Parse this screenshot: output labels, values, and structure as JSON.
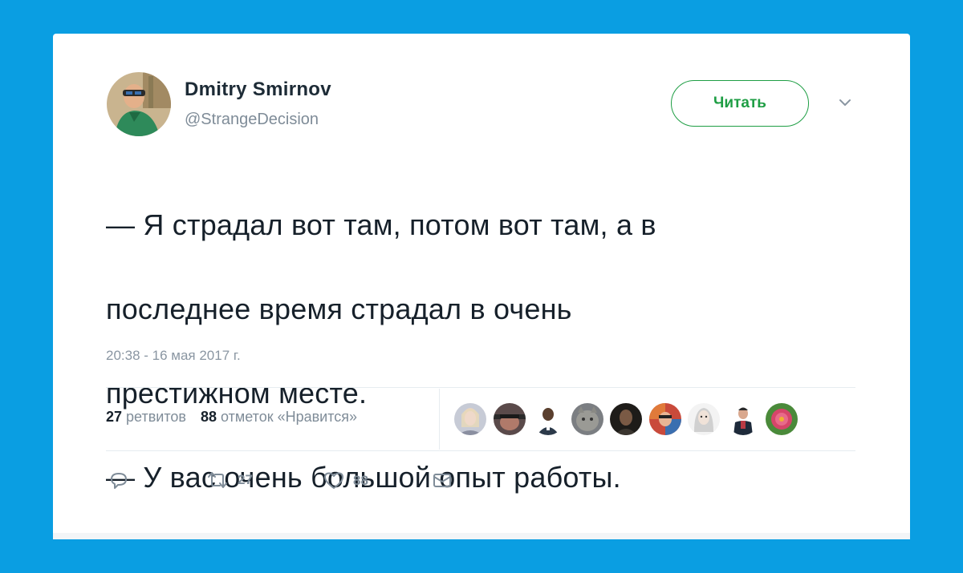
{
  "tweet": {
    "author_name": "Dmitry Smirnov",
    "author_handle": "@StrangeDecision",
    "follow_label": "Читать",
    "text_lines": [
      "— Я страдал вот там, потом вот там, а в",
      "последнее время страдал в очень",
      "престижном месте.",
      "— У вас очень большой опыт работы."
    ],
    "timestamp": "20:38 - 16 мая 2017 г."
  },
  "stats": {
    "retweets_count": "27",
    "retweets_label": "ретвитов",
    "likes_count": "88",
    "likes_label": "отметок «Нравится»"
  },
  "likers": [
    {
      "icon": "liker-avatar-1",
      "color": "#b8bcc7"
    },
    {
      "icon": "liker-avatar-2",
      "color": "#5a4a4a"
    },
    {
      "icon": "liker-avatar-3",
      "color": "#3a4550"
    },
    {
      "icon": "liker-avatar-4",
      "color": "#7b7e82"
    },
    {
      "icon": "liker-avatar-5",
      "color": "#2c2a26"
    },
    {
      "icon": "liker-avatar-6",
      "color": "#c94a3b"
    },
    {
      "icon": "liker-avatar-7",
      "color": "#d8d8d8"
    },
    {
      "icon": "liker-avatar-8",
      "color": "#b93a44"
    },
    {
      "icon": "liker-avatar-9",
      "color": "#d6456a"
    }
  ],
  "actions": {
    "reply_icon": "reply-icon",
    "retweet_icon": "retweet-icon",
    "retweet_count": "27",
    "like_icon": "heart-icon",
    "like_count": "88",
    "dm_icon": "envelope-icon"
  },
  "colors": {
    "background": "#0a9ee2",
    "follow_accent": "#1e9e44",
    "secondary_text": "#7f8c98"
  }
}
